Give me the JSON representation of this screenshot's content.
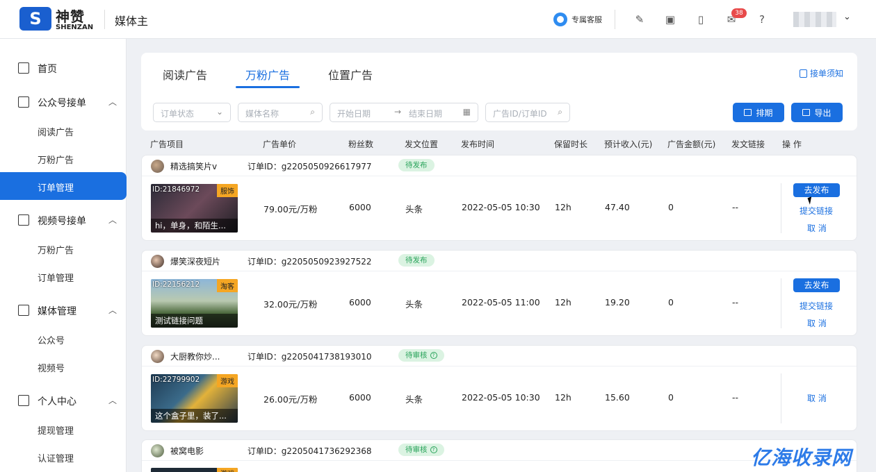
{
  "header": {
    "logo_text": "S",
    "brand": "神赞",
    "brand_en": "SHENZAN",
    "app_name": "媒体主",
    "support_label": "专属客服",
    "icons": [
      "feather-icon",
      "calendar-points-icon",
      "tablet-icon",
      "mail-icon",
      "help-icon"
    ],
    "mail_badge": "38"
  },
  "sidebar": {
    "items": [
      {
        "type": "group",
        "label": "首页",
        "icon": "monitor-icon"
      },
      {
        "type": "group",
        "label": "公众号接单",
        "icon": "building-icon",
        "chevron": "^"
      },
      {
        "type": "sub",
        "label": "阅读广告"
      },
      {
        "type": "sub",
        "label": "万粉广告"
      },
      {
        "type": "sub",
        "label": "订单管理",
        "active": true
      },
      {
        "type": "group",
        "label": "视频号接单",
        "icon": "video-doc-icon",
        "chevron": "^"
      },
      {
        "type": "sub",
        "label": "万粉广告"
      },
      {
        "type": "sub",
        "label": "订单管理"
      },
      {
        "type": "group",
        "label": "媒体管理",
        "icon": "wallet-icon",
        "chevron": "^"
      },
      {
        "type": "sub",
        "label": "公众号"
      },
      {
        "type": "sub",
        "label": "视频号"
      },
      {
        "type": "group",
        "label": "个人中心",
        "icon": "person-icon",
        "chevron": "^"
      },
      {
        "type": "sub",
        "label": "提现管理"
      },
      {
        "type": "sub",
        "label": "认证管理"
      }
    ]
  },
  "tabs": [
    "阅读广告",
    "万粉广告",
    "位置广告"
  ],
  "notice": "接单须知",
  "filters": {
    "status_placeholder": "订单状态",
    "media_placeholder": "媒体名称",
    "start_date": "开始日期",
    "end_date": "结束日期",
    "id_placeholder": "广告ID/订单ID",
    "schedule_button": "排期",
    "export_button": "导出"
  },
  "columns": [
    "广告项目",
    "广告单价",
    "粉丝数",
    "发文位置",
    "发布时间",
    "保留时长",
    "预计收入(元)",
    "广告金额(元)",
    "发文链接",
    "操 作"
  ],
  "orders": [
    {
      "account": "精选搞笑片v",
      "order_label": "订单ID：",
      "order_id": "g2205050926617977",
      "status": "待发布",
      "status_help": false,
      "ad_id": "ID:21846972",
      "category": "服饰",
      "caption": "hi，单身，和陌生...",
      "price": "79.00元/万粉",
      "fans": "6000",
      "position": "头条",
      "time": "2022-05-05 10:30",
      "retain": "12h",
      "income": "47.40",
      "amount": "0",
      "link": "--",
      "publish": "去发布",
      "submit": "提交链接",
      "cancel": "取 消"
    },
    {
      "account": "爆笑深夜短片",
      "order_label": "订单ID：",
      "order_id": "g2205050923927522",
      "status": "待发布",
      "status_help": false,
      "ad_id": "ID:22156212",
      "category": "淘客",
      "caption": "测试链接问题",
      "price": "32.00元/万粉",
      "fans": "6000",
      "position": "头条",
      "time": "2022-05-05 11:00",
      "retain": "12h",
      "income": "19.20",
      "amount": "0",
      "link": "--",
      "publish": "去发布",
      "submit": "提交链接",
      "cancel": "取 消"
    },
    {
      "account": "大厨教你炒...",
      "order_label": "订单ID：",
      "order_id": "g2205041738193010",
      "status": "待审核",
      "status_help": true,
      "ad_id": "ID:22799902",
      "category": "游戏",
      "caption": "这个盒子里，装了...",
      "price": "26.00元/万粉",
      "fans": "6000",
      "position": "头条",
      "time": "2022-05-05 10:30",
      "retain": "12h",
      "income": "15.60",
      "amount": "0",
      "link": "--",
      "publish": "",
      "submit": "",
      "cancel": "取 消"
    },
    {
      "account": "被窝电影",
      "order_label": "订单ID：",
      "order_id": "g2205041736292368",
      "status": "待审核",
      "status_help": true,
      "ad_id": "",
      "category": "游戏",
      "caption": "",
      "price": "",
      "fans": "",
      "position": "",
      "time": "",
      "retain": "",
      "income": "",
      "amount": "",
      "link": "",
      "publish": "",
      "submit": "",
      "cancel": ""
    }
  ],
  "watermark": "亿海收录网",
  "colors": {
    "accent": "#1a6fe0",
    "status_bg": "#dbf3e2",
    "status_text": "#29a35a",
    "tag": "#f5a623",
    "badge": "#e84a4a"
  }
}
